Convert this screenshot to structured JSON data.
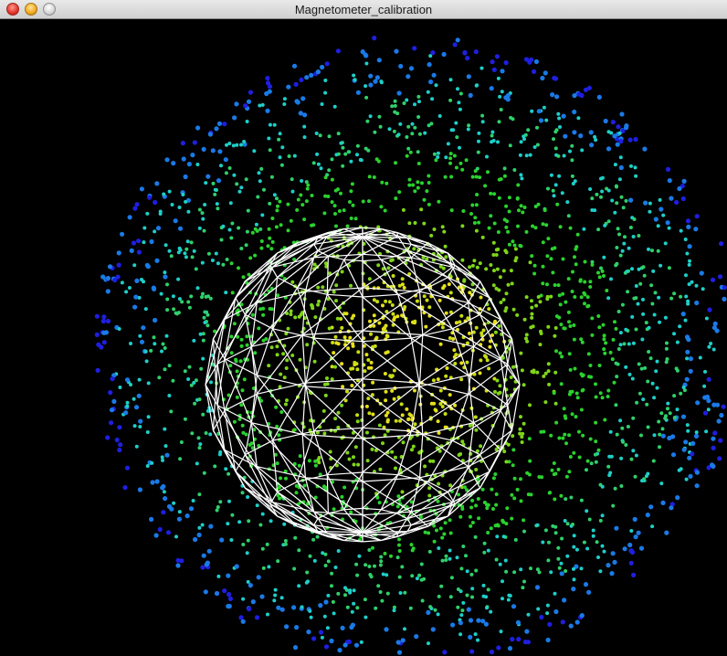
{
  "window": {
    "title": "Magnetometer_calibration",
    "buttons": {
      "close": "close-icon",
      "minimize": "minimize-icon",
      "zoom": "zoom-icon"
    }
  },
  "scene": {
    "background": "#000000",
    "sphere_color": "#ffffff",
    "point_colors": [
      "#1f1fe0",
      "#1a7ae6",
      "#1ecfc8",
      "#2fd06a",
      "#2bd12f",
      "#7fd51a",
      "#c9dd12",
      "#e6e01a"
    ]
  }
}
